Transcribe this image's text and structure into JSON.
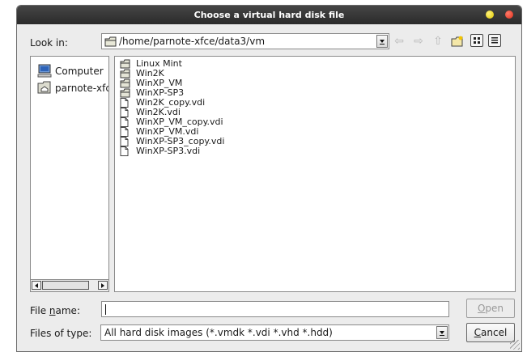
{
  "window": {
    "title": "Choose a virtual hard disk file"
  },
  "look_in": {
    "label": "Look in:",
    "path": "/home/parnote-xfce/data3/vm"
  },
  "toolbar": {
    "back_icon": "back-arrow-icon",
    "forward_icon": "forward-arrow-icon",
    "up_icon": "up-arrow-icon",
    "new_folder_icon": "new-folder-icon",
    "list_view_icon": "icon-view-icon",
    "detail_view_icon": "detail-view-icon"
  },
  "places": [
    {
      "label": "Computer",
      "icon": "computer-icon"
    },
    {
      "label": "parnote-xfce",
      "icon": "home-folder-icon"
    }
  ],
  "files": [
    {
      "name": "Linux Mint",
      "type": "folder"
    },
    {
      "name": "Win2K",
      "type": "folder"
    },
    {
      "name": "WinXP_VM",
      "type": "folder"
    },
    {
      "name": "WinXP-SP3",
      "type": "folder"
    },
    {
      "name": "Win2K_copy.vdi",
      "type": "file"
    },
    {
      "name": "Win2K.vdi",
      "type": "file"
    },
    {
      "name": "WinXP_VM_copy.vdi",
      "type": "file"
    },
    {
      "name": "WinXP_VM.vdi",
      "type": "file"
    },
    {
      "name": "WinXP-SP3_copy.vdi",
      "type": "file"
    },
    {
      "name": "WinXP-SP3.vdi",
      "type": "file"
    }
  ],
  "file_name": {
    "label_pre": "File ",
    "label_mnemonic": "n",
    "label_post": "ame:",
    "value": ""
  },
  "file_type": {
    "label": "Files of type:",
    "selected": "All hard disk images (*.vmdk *.vdi *.vhd *.hdd)"
  },
  "buttons": {
    "open_mnemonic": "O",
    "open_rest": "pen",
    "cancel_mnemonic": "C",
    "cancel_rest": "ancel"
  },
  "colors": {
    "titlebar": "#2b2b2b",
    "dialog_bg": "#ececec",
    "minimize": "#f2dc2a",
    "close": "#e8412c"
  }
}
